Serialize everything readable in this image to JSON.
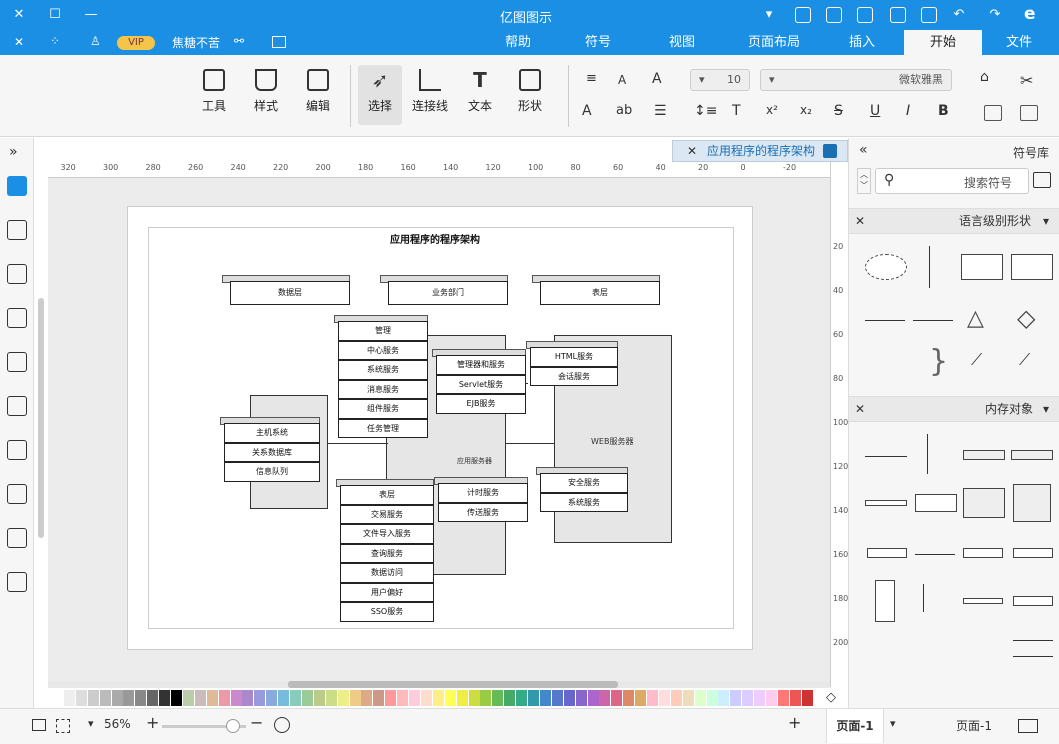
{
  "window": {
    "title": "亿图图示"
  },
  "quick_access": [
    "undo",
    "redo"
  ],
  "menu": {
    "tabs": [
      {
        "label": "文件"
      },
      {
        "label": "开始"
      },
      {
        "label": "插入"
      },
      {
        "label": "页面布局"
      },
      {
        "label": "视图"
      },
      {
        "label": "符号"
      },
      {
        "label": "帮助"
      }
    ],
    "user": {
      "name": "焦糖不苦",
      "vip": "VIP"
    }
  },
  "ribbon": {
    "groups": [
      {
        "label": "形状"
      },
      {
        "label": "文本"
      },
      {
        "label": "连接线"
      },
      {
        "label": "选择"
      },
      {
        "label": "编辑"
      },
      {
        "label": "样式"
      },
      {
        "label": "工具"
      }
    ],
    "font_name": "微软雅黑",
    "font_size": "10"
  },
  "document": {
    "tab_title": "应用程序的程序架构"
  },
  "ruler": {
    "h_ticks": [
      "-20",
      "0",
      "20",
      "40",
      "60",
      "80",
      "100",
      "120",
      "140",
      "160",
      "180",
      "200",
      "220",
      "240",
      "260",
      "280",
      "300",
      "320"
    ],
    "v_ticks": [
      "20",
      "40",
      "60",
      "80",
      "100",
      "120",
      "140",
      "160",
      "180",
      "200"
    ]
  },
  "diagram": {
    "title": "应用程序的程序架构",
    "top_nodes": [
      "数据层",
      "业务部门",
      "表层"
    ],
    "center_group": [
      "管理",
      "中心服务",
      "系统服务",
      "消息服务",
      "组件服务",
      "任务管理"
    ],
    "service_group": [
      "管理器和服务",
      "Servlet服务",
      "EJB服务"
    ],
    "right_group": [
      "HTML服务",
      "会话服务"
    ],
    "web_label": "WEB服务器",
    "left_group": [
      "主机系统",
      "关系数据库",
      "信息队列"
    ],
    "app_label": "应用服务器",
    "bottom_group": [
      "表层",
      "交易服务",
      "文件导入服务",
      "查询服务",
      "数据访问",
      "用户偏好",
      "SSO服务"
    ],
    "bottom_mid": [
      "计时服务",
      "传送服务"
    ],
    "bottom_right": [
      "安全服务",
      "系统服务"
    ]
  },
  "right_panel": {
    "title": "符号库",
    "search_placeholder": "搜索符号",
    "sections": [
      {
        "title": "语言级别形状"
      },
      {
        "title": "内存对象"
      }
    ]
  },
  "status": {
    "page_label": "页面-1",
    "page_tab": "页面-1",
    "zoom": "56%"
  }
}
